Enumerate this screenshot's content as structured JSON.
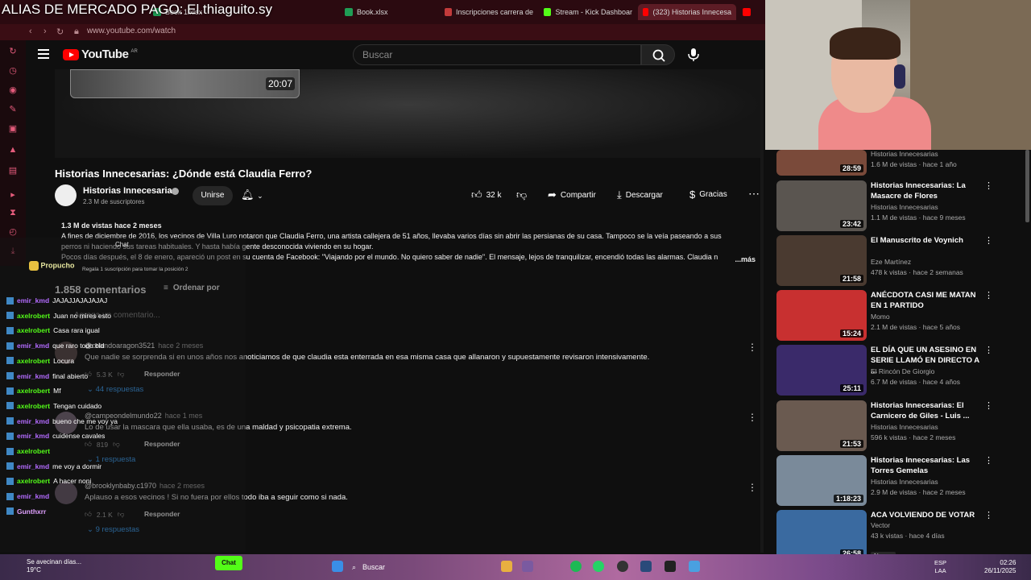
{
  "overlay_title": "ALIAS DE MERCADO PAGO: El.thiaguito.sy",
  "tabs": [
    {
      "label": "Stream - Kick Dashboar",
      "color": "#53fc18"
    },
    {
      "label": "Inscripciones carrera de",
      "color": "#c23b3b"
    },
    {
      "label": "Book.xlsx",
      "color": "#1f9d55"
    },
    {
      "label": "Book 1.xlsx",
      "color": "#1f9d55"
    },
    {
      "label": "(323) Historias Innecesa",
      "color": "#ff0000"
    }
  ],
  "address": {
    "url": "www.youtube.com/watch"
  },
  "youtube": {
    "logo_text": "YouTube",
    "country": "AR",
    "search_placeholder": "Buscar"
  },
  "player": {
    "endcard_duration": "20:07"
  },
  "video": {
    "title": "Historias Innecesarias: ¿Dónde está Claudia Ferro?",
    "channel": "Historias Innecesarias",
    "subscribers": "2.3 M de suscriptores",
    "subscribe_label": "Unirse",
    "likes": "32 k",
    "share_label": "Compartir",
    "download_label": "Descargar",
    "thanks_label": "Gracias"
  },
  "description": {
    "head": "1.3 M de vistas  hace 2 meses",
    "line1": "A fines de diciembre de 2016, los vecinos de Villa Luro notaron que Claudia Ferro, una artista callejera de 51 años, llevaba varios días sin abrir las persianas de su casa. Tampoco se la veía paseando a sus",
    "line2": "perros ni haciendo sus tareas habituales. Y hasta había gente desconocida viviendo en su hogar.",
    "line3": "Pocos días después, el 8 de enero, apareció un post en su cuenta de Facebook: \"Viajando por el mundo. No quiero saber de nadie\". El mensaje, lejos de tranquilizar, encendió todas las alarmas. Claudia n",
    "more": "...más"
  },
  "comments": {
    "count_label": "1.858 comentarios",
    "sort_label": "Ordenar por",
    "add_placeholder": "Agrega un comentario...",
    "items": [
      {
        "author": "@orlandoaragon3521",
        "time": "hace 2 meses",
        "text": "Que nadie se sorprenda si en unos años nos anoticiamos de que claudia esta enterrada en esa misma casa que allanaron y supuestamente revisaron intensivamente.",
        "likes": "5.3 K",
        "reply": "Responder",
        "replies": "44 respuestas"
      },
      {
        "author": "@campeondelmundo22",
        "time": "hace 1 mes",
        "text": "Lo de usar la mascara que ella usaba, es de una maldad y psicopatia extrema.",
        "likes": "819",
        "reply": "Responder",
        "replies": "1 respuesta"
      },
      {
        "author": "@brooklynbaby.c1970",
        "time": "hace 2 meses",
        "text": "Aplauso a esos vecinos ! Si no fuera por ellos todo iba a seguir como si nada.",
        "likes": "2.1 K",
        "reply": "Responder",
        "replies": "9 respuestas"
      }
    ]
  },
  "chat": {
    "label": "Chat",
    "top_user": "Propucho",
    "top_user_sub": "Regala 1 suscripción para tomar la posición 2",
    "lines": [
      {
        "user": "emir_kmd",
        "msg": "JAJAJJAJAJAJAJ",
        "color": "#b36bff"
      },
      {
        "user": "axelrobert",
        "msg": "Juan no mires esto",
        "color": "#53fc18"
      },
      {
        "user": "axelrobert",
        "msg": "Casa rara igual",
        "color": "#53fc18"
      },
      {
        "user": "emir_kmd",
        "msg": "que raro todo bld",
        "color": "#b36bff"
      },
      {
        "user": "axelrobert",
        "msg": "Locura",
        "color": "#53fc18"
      },
      {
        "user": "emir_kmd",
        "msg": "final abierto",
        "color": "#b36bff"
      },
      {
        "user": "axelrobert",
        "msg": "Mf",
        "color": "#53fc18"
      },
      {
        "user": "axelrobert",
        "msg": "Tengan cuidado",
        "color": "#53fc18"
      },
      {
        "user": "emir_kmd",
        "msg": "bueno che me voy ya",
        "color": "#b36bff"
      },
      {
        "user": "emir_kmd",
        "msg": "cuidense cavales",
        "color": "#b36bff"
      },
      {
        "user": "axelrobert",
        "msg": "",
        "color": "#53fc18"
      },
      {
        "user": "emir_kmd",
        "msg": "me voy a dormir",
        "color": "#b36bff"
      },
      {
        "user": "axelrobert",
        "msg": "A hacer noni",
        "color": "#53fc18"
      },
      {
        "user": "emir_kmd",
        "msg": "",
        "color": "#b36bff"
      },
      {
        "user": "Gunthxrr",
        "msg": "",
        "color": "#e0a0ff"
      }
    ]
  },
  "sidebar": [
    {
      "title": "",
      "channel": "Historias Innecesarias",
      "meta": "1.6 M de vistas · hace 1 año",
      "duration": "28:59",
      "thumb": "#7a4a3a"
    },
    {
      "title": "Historias Innecesarias: La Masacre de Flores",
      "channel": "Historias Innecesarias",
      "meta": "1.1 M de vistas · hace 9 meses",
      "duration": "23:42",
      "thumb": "#5a5550"
    },
    {
      "title": "El Manuscrito de Voynich",
      "channel": "Eze Martínez",
      "meta": "478 k vistas · hace 2 semanas",
      "duration": "21:58",
      "thumb": "#4a3a30"
    },
    {
      "title": "ANÉCDOTA CASI ME MATAN EN 1 PARTIDO",
      "channel": "Momo",
      "meta": "2.1 M de vistas · hace 5 años",
      "duration": "15:24",
      "thumb": "#c83030"
    },
    {
      "title": "EL DÍA QUE UN ASESINO EN SERIE LLAMÓ EN DIRECTO A ...",
      "channel": "El Rincón De Giorgio",
      "meta": "6.7 M de vistas · hace 4 años",
      "duration": "25:11",
      "thumb": "#3a2a6a"
    },
    {
      "title": "Historias Innecesarias: El Carnicero de Giles - Luis ...",
      "channel": "Historias Innecesarias",
      "meta": "596 k vistas · hace 2 meses",
      "duration": "21:53",
      "thumb": "#6a5a50"
    },
    {
      "title": "Historias Innecesarias: Las Torres Gemelas",
      "channel": "Historias Innecesarias",
      "meta": "2.9 M de vistas · hace 2 meses",
      "duration": "1:18:23",
      "thumb": "#7a8a9a"
    },
    {
      "title": "ACA VOLVIENDO DE VOTAR",
      "channel": "Vector",
      "meta": "43 k vistas · hace 4 días",
      "duration": "26:58",
      "thumb": "#3a6aa0",
      "tag": "Nuevo"
    }
  ],
  "taskbar": {
    "weather_line1": "Se avecinan días...",
    "weather_line2": "19°C",
    "chat_button": "Chat",
    "search_label": "Buscar",
    "lang_line1": "ESP",
    "lang_line2": "LAA",
    "time": "02:26",
    "date": "26/11/2025"
  }
}
